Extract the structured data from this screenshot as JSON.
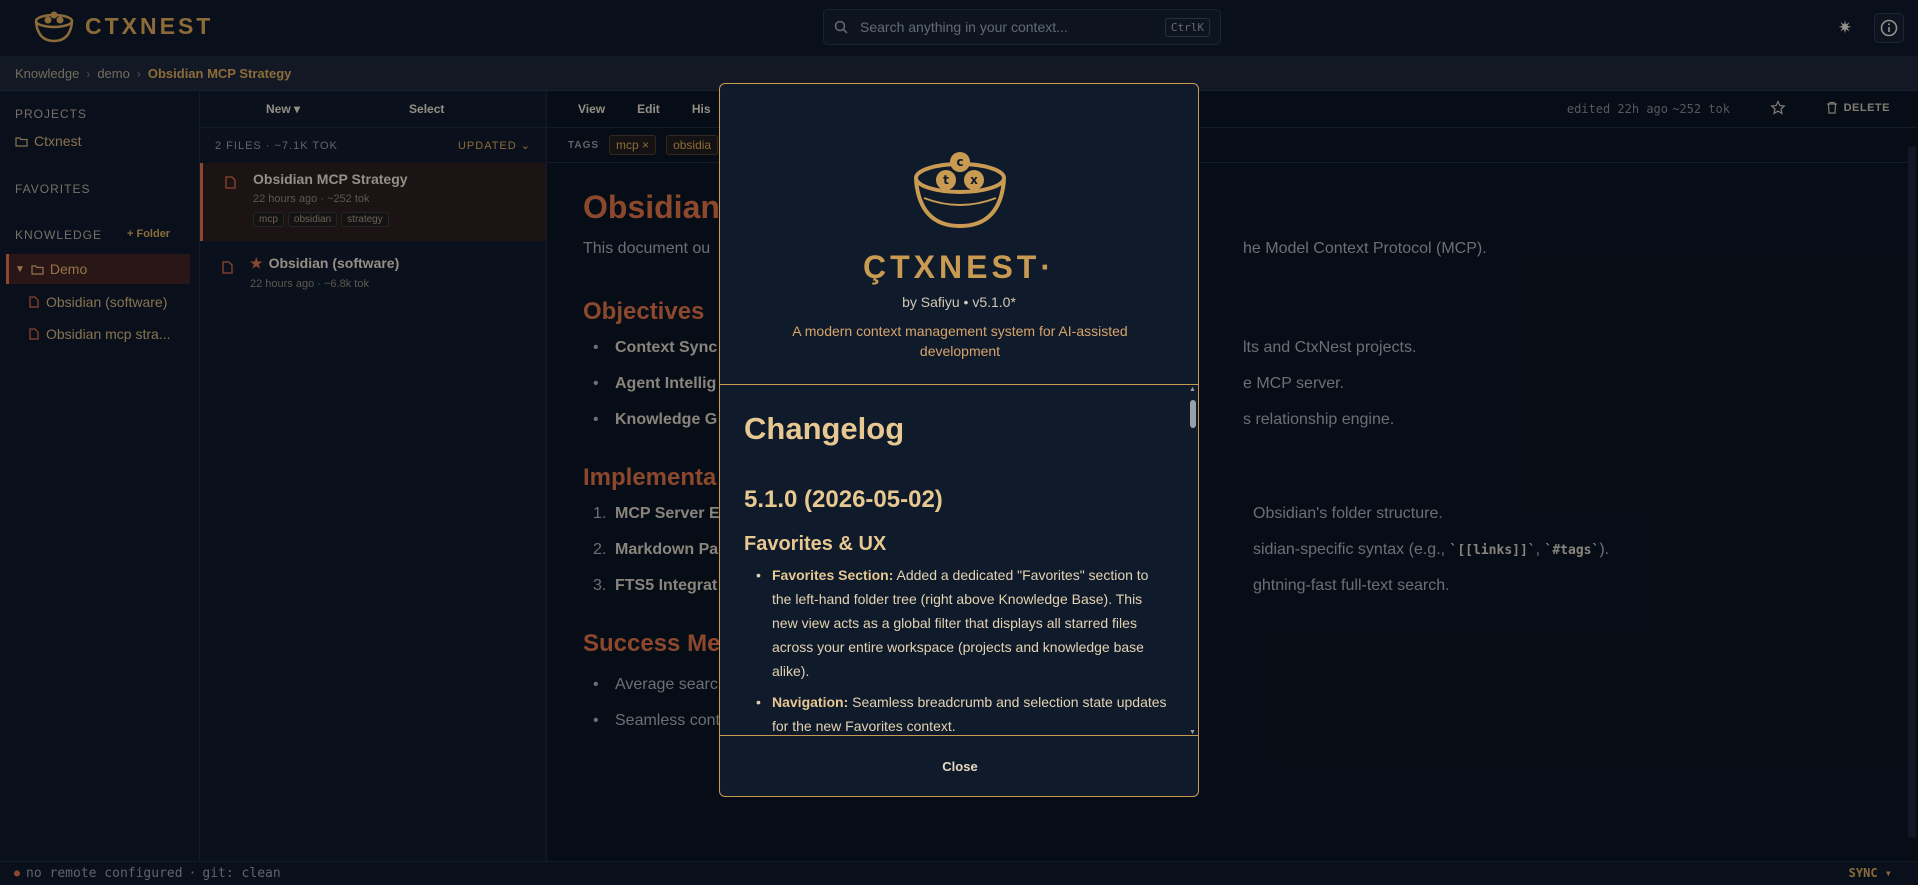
{
  "app": {
    "name": "CTXNEST",
    "search_placeholder": "Search anything in your context...",
    "search_shortcut": "CtrlK"
  },
  "breadcrumb": [
    "Knowledge",
    "demo",
    "Obsidian MCP Strategy"
  ],
  "sidebar": {
    "projects_label": "PROJECTS",
    "project": "Ctxnest",
    "favorites_label": "FAVORITES",
    "knowledge_label": "KNOWLEDGE",
    "add_folder": "+ Folder",
    "folder": "Demo",
    "files": [
      "Obsidian (software)",
      "Obsidian mcp stra..."
    ]
  },
  "filelist": {
    "new_label": "New ▾",
    "select_label": "Select",
    "meta": "2 FILES · ~7.1K TOK",
    "sort": "UPDATED",
    "files": [
      {
        "title": "Obsidian MCP Strategy",
        "sub": "22 hours ago · ~252 tok",
        "tags": [
          "mcp",
          "obsidian",
          "strategy"
        ]
      },
      {
        "title": "Obsidian (software)",
        "sub": "22 hours ago · ~6.8k tok"
      }
    ]
  },
  "content": {
    "tabs": [
      "View",
      "Edit",
      "His"
    ],
    "edited": "edited 22h ago",
    "tokens": "~252 tok",
    "delete_label": "DELETE",
    "tags_label": "TAGS",
    "tags": [
      "mcp ×",
      "obsidia"
    ],
    "title": "Obsidian",
    "intro_left": "This document ou",
    "intro_right": "he Model Context Protocol (MCP).",
    "h_objectives": "Objectives",
    "objectives": [
      {
        "bold": "Context Sync",
        "rest": "lts and CtxNest projects."
      },
      {
        "bold": "Agent Intellig",
        "rest": "e MCP server."
      },
      {
        "bold": "Knowledge G",
        "rest": "s relationship engine."
      }
    ],
    "h_impl": "Implementa",
    "impl": [
      {
        "num": "1.",
        "bold": "MCP Server E",
        "rest": "Obsidian's folder structure."
      },
      {
        "num": "2.",
        "bold": "Markdown Pa",
        "rest": "sidian-specific syntax (e.g., ",
        "code1": "`[[links]]`",
        "sep": ", ",
        "code2": "`#tags`",
        "end": ")."
      },
      {
        "num": "3.",
        "bold": "FTS5 Integrat",
        "rest": "ghtning-fast full-text search."
      }
    ],
    "h_success": "Success Me",
    "success": [
      "Average searc",
      "Seamless context bundling for coding tasks involving personal notes."
    ]
  },
  "statusbar": {
    "remote": "no remote configured",
    "git": "git: clean",
    "sync": "SYNC ▾"
  },
  "modal": {
    "brand": "ÇTXNEST·",
    "by": "by Safiyu • v5.1.0*",
    "tagline": "A modern context management system for AI-assisted development",
    "changelog_title": "Changelog",
    "version": "5.1.0 (2026-05-02)",
    "section": "Favorites & UX",
    "items": [
      {
        "bold": "Favorites Section:",
        "text": " Added a dedicated \"Favorites\" section to the left-hand folder tree (right above Knowledge Base). This new view acts as a global filter that displays all starred files across your entire workspace (projects and knowledge base alike)."
      },
      {
        "bold": "Navigation:",
        "text": " Seamless breadcrumb and selection state updates for the new Favorites context."
      }
    ],
    "close": "Close"
  },
  "colors": {
    "accent": "#c99a52",
    "heading": "#c9683f",
    "background": "#0b1320"
  }
}
